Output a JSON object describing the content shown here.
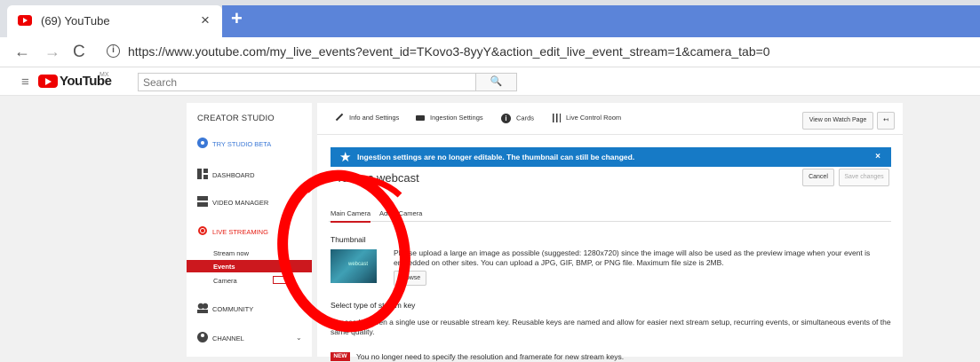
{
  "browser": {
    "tab_title": "(69) YouTube",
    "tab_close": "×",
    "new_tab": "+",
    "back": "←",
    "forward": "→",
    "reload": "C",
    "info": "i",
    "url": "https://www.youtube.com/my_live_events?event_id=TKovo3-8yyY&action_edit_live_event_stream=1&camera_tab=0"
  },
  "header": {
    "menu_icon": "≡",
    "brand": "YouTube",
    "country": "MX",
    "search_placeholder": "Search",
    "search_button": "🔍"
  },
  "sidebar": {
    "title": "CREATOR STUDIO",
    "items": [
      {
        "label": "TRY STUDIO BETA"
      },
      {
        "label": "DASHBOARD"
      },
      {
        "label": "VIDEO MANAGER"
      },
      {
        "label": "LIVE STREAMING"
      },
      {
        "label": "COMMUNITY"
      },
      {
        "label": "CHANNEL"
      }
    ],
    "live_sub": [
      {
        "label": "Stream now"
      },
      {
        "label": "Events"
      },
      {
        "label": "Camera"
      }
    ],
    "chevron": "⌄"
  },
  "main": {
    "tabs": [
      {
        "label": "Info and Settings"
      },
      {
        "label": "Ingestion Settings"
      },
      {
        "label": "Cards"
      },
      {
        "label": "Live Control Room"
      }
    ],
    "view_watch_page": "View on Watch Page",
    "share_icon_text": "↤",
    "banner": {
      "message": "Ingestion settings are no longer editable. The thumbnail can still be changed.",
      "close": "×"
    },
    "event_title": "Pruebas webcast",
    "cancel": "Cancel",
    "save_changes": "Save changes",
    "camera_tabs": [
      {
        "label": "Main Camera"
      },
      {
        "label": "Add a Camera"
      }
    ],
    "thumbnail": {
      "heading": "Thumbnail",
      "desc_line1": "Please upload a large an image as possible (suggested: 1280x720) since the image will also be used as the preview image when your event is",
      "desc_line2": "embedded on other sites. You can upload a JPG, GIF, BMP, or PNG file. Maximum file size is 2MB.",
      "watermark": "webcast",
      "browse": "Browse"
    },
    "stream_key": {
      "heading": "Select type of stream key",
      "desc_line1": "Choose between a single use or reusable stream key. Reusable keys are named and allow for easier next stream setup, recurring events, or simultaneous events of the",
      "desc_line2": "same quality."
    },
    "new_badge": "NEW",
    "new_text": "You no longer need to specify the resolution and framerate for new stream keys."
  }
}
